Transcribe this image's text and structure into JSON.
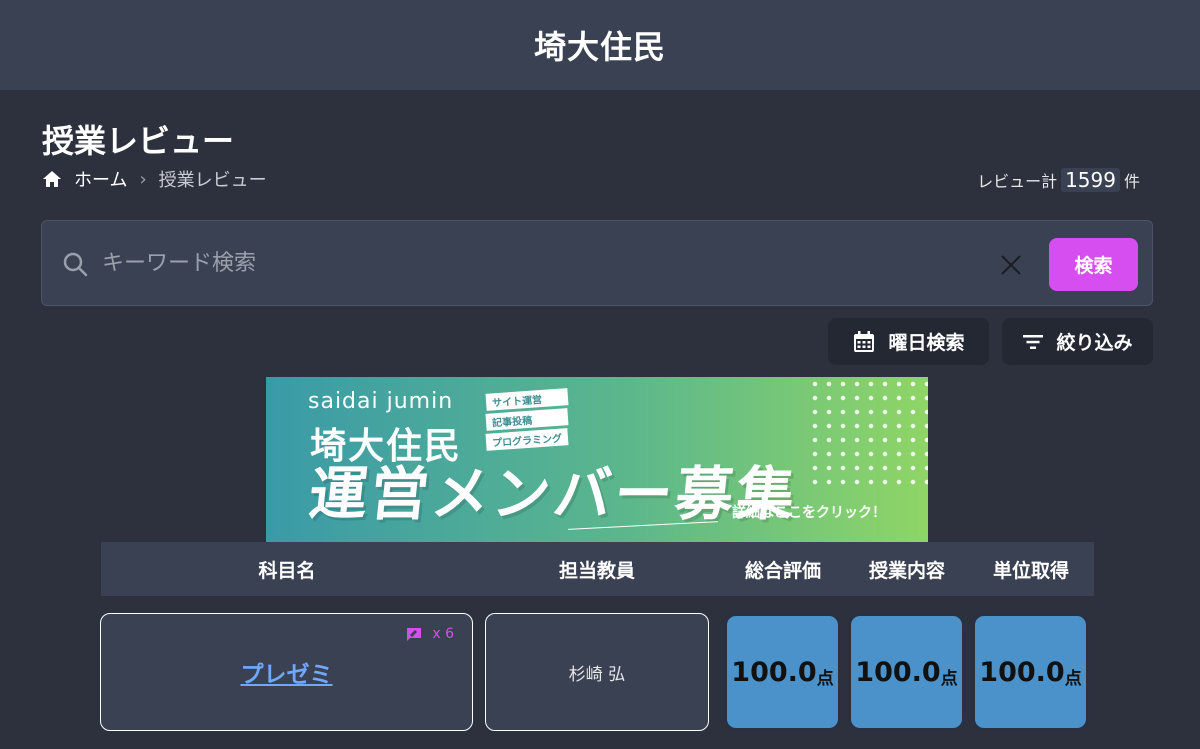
{
  "header": {
    "site_title": "埼大住民"
  },
  "page": {
    "title": "授業レビュー",
    "breadcrumb": {
      "home": "ホーム",
      "current": "授業レビュー"
    },
    "review_count": {
      "prefix": "レビュー計",
      "count": "1599",
      "suffix": "件"
    }
  },
  "search": {
    "placeholder": "キーワード検索",
    "value": "",
    "button_label": "検索"
  },
  "filters": {
    "day_search_label": "曜日検索",
    "narrow_label": "絞り込み"
  },
  "banner": {
    "subtitle": "saidai jumin",
    "name": "埼大住民",
    "tags": [
      "サイト運営",
      "記事投稿",
      "プログラミング"
    ],
    "headline": "運営メンバー募集",
    "cta": "詳細はここをクリック！"
  },
  "table": {
    "columns": [
      "科目名",
      "担当教員",
      "総合評価",
      "授業内容",
      "単位取得"
    ],
    "rows": [
      {
        "subject": "プレゼミ",
        "comment_count": "x 6",
        "teacher": "杉崎 弘",
        "overall": "100.0",
        "content": "100.0",
        "credit": "100.0",
        "unit": "点"
      }
    ]
  },
  "colors": {
    "accent": "#d64ef0",
    "score_bg": "#4a92c9",
    "link": "#6ea8ff",
    "background": "#2c313d",
    "header_bg": "#3a4152"
  }
}
